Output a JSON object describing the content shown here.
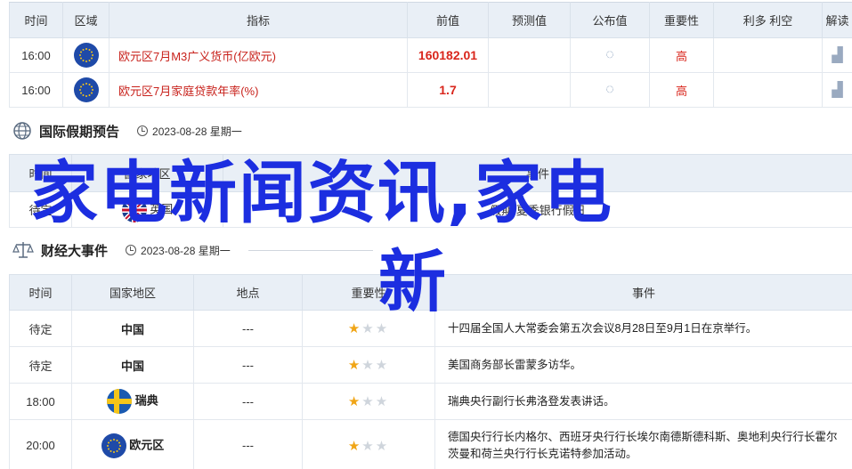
{
  "top_table": {
    "headers": [
      "时间",
      "区域",
      "指标",
      "前值",
      "预测值",
      "公布值",
      "重要性",
      "利多 利空",
      "解读"
    ],
    "rows": [
      {
        "time": "16:00",
        "indicator": "欧元区7月M3广义货币(亿欧元)",
        "prev": "160182.01",
        "importance": "高"
      },
      {
        "time": "16:00",
        "indicator": "欧元区7月家庭贷款年率(%)",
        "prev": "1.7",
        "importance": "高"
      }
    ]
  },
  "holiday": {
    "title": "国际假期预告",
    "date": "2023-08-28 星期一",
    "headers": [
      "时间",
      "国家地区",
      "事件"
    ],
    "row": {
      "time": "待定",
      "country": "英国",
      "event": "假期 夏季银行假日"
    }
  },
  "events": {
    "title": "财经大事件",
    "date": "2023-08-28 星期一",
    "headers": [
      "时间",
      "国家地区",
      "地点",
      "重要性",
      "事件"
    ],
    "rows": [
      {
        "time": "待定",
        "country": "中国",
        "place": "---",
        "event": "十四届全国人大常委会第五次会议8月28日至9月1日在京举行。",
        "stars": 1
      },
      {
        "time": "待定",
        "country": "中国",
        "place": "---",
        "event": "美国商务部长雷蒙多访华。",
        "stars": 1
      },
      {
        "time": "18:00",
        "country": "瑞典",
        "place": "---",
        "event": "瑞典央行副行长弗洛登发表讲话。",
        "stars": 1
      },
      {
        "time": "20:00",
        "country": "欧元区",
        "place": "---",
        "event_line1": "德国央行行长内格尔、西班牙央行行长埃尔南德斯德科斯、奥地利央行行长霍尔",
        "event_line2": "茨曼和荷兰央行行长克诺特参加活动。",
        "stars": 1
      }
    ]
  },
  "overlay": {
    "line1": "家电新闻资讯,家电",
    "line2": "新"
  },
  "icons": {
    "spinner": "loading-icon",
    "chart": "chart-icon",
    "globe": "globe-icon",
    "balance": "balance-icon",
    "clock": "clock-icon"
  },
  "colors": {
    "header_bg": "#e9eff6",
    "indicator_red": "#c8211b",
    "overlay_blue": "#1c2ee0",
    "star_on": "#f0a516"
  }
}
